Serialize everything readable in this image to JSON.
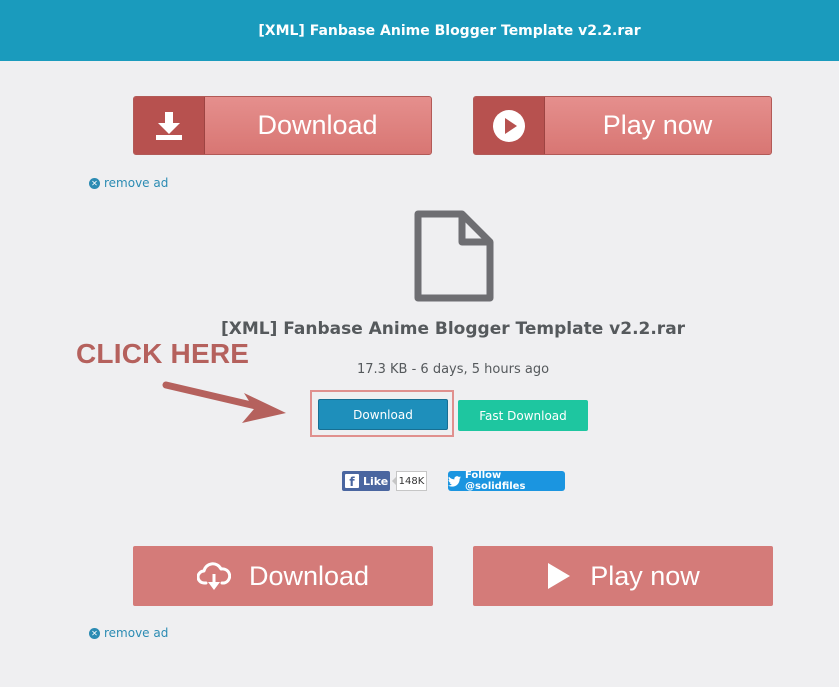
{
  "header": {
    "title": "[XML] Fanbase Anime Blogger Template v2.2.rar"
  },
  "ads_top": {
    "download_label": "Download",
    "play_label": "Play now",
    "remove_ad_label": "remove ad"
  },
  "file": {
    "name": "[XML] Fanbase Anime Blogger Template v2.2.rar",
    "meta": "17.3 KB - 6 days, 5 hours ago",
    "icon": "file-icon"
  },
  "annotation": {
    "text": "CLICK HERE"
  },
  "actions": {
    "download_label": "Download",
    "fast_download_label": "Fast Download"
  },
  "social": {
    "like_label": "Like",
    "like_count": "148K",
    "follow_label": "Follow @solidfiles"
  },
  "ads_bottom": {
    "download_label": "Download",
    "play_label": "Play now",
    "remove_ad_label": "remove ad"
  },
  "colors": {
    "header_bg": "#1a9bbd",
    "ad_button": "#d87673",
    "download_button": "#1e8fbb",
    "fast_download_button": "#1ec6a0",
    "annotation": "#b5615d"
  }
}
